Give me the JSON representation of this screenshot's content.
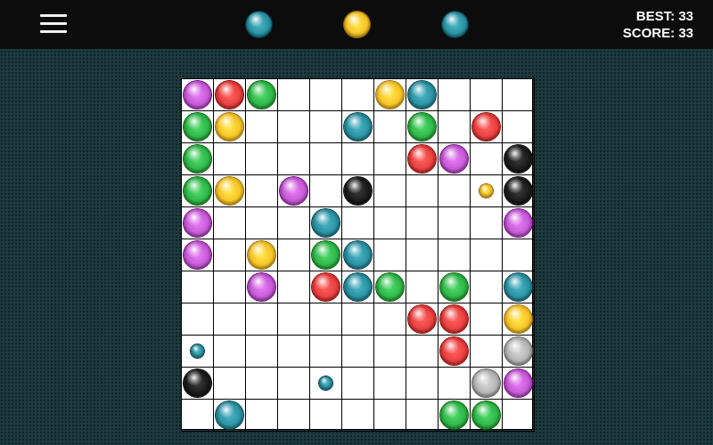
{
  "colors": {
    "purple": "#c75ad6",
    "red": "#e8403f",
    "green": "#2fb84a",
    "yellow": "#f7c427",
    "teal": "#2a93a3",
    "black": "#1a1a1a",
    "gray": "#b5b5b5"
  },
  "header": {
    "menu_icon": "hamburger-menu-icon",
    "next_balls": [
      "teal",
      "yellow",
      "teal"
    ],
    "best_label": "BEST:",
    "best_value": "33",
    "score_label": "SCORE:",
    "score_value": "33"
  },
  "board": {
    "rows": 11,
    "cols": 11,
    "balls": [
      {
        "row": 0,
        "col": 0,
        "color": "purple",
        "size": "big"
      },
      {
        "row": 0,
        "col": 1,
        "color": "red",
        "size": "big"
      },
      {
        "row": 0,
        "col": 2,
        "color": "green",
        "size": "big"
      },
      {
        "row": 0,
        "col": 6,
        "color": "yellow",
        "size": "big"
      },
      {
        "row": 0,
        "col": 7,
        "color": "teal",
        "size": "big"
      },
      {
        "row": 1,
        "col": 0,
        "color": "green",
        "size": "big"
      },
      {
        "row": 1,
        "col": 1,
        "color": "yellow",
        "size": "big"
      },
      {
        "row": 1,
        "col": 5,
        "color": "teal",
        "size": "big"
      },
      {
        "row": 1,
        "col": 7,
        "color": "green",
        "size": "big"
      },
      {
        "row": 1,
        "col": 9,
        "color": "red",
        "size": "big"
      },
      {
        "row": 2,
        "col": 0,
        "color": "green",
        "size": "big"
      },
      {
        "row": 2,
        "col": 7,
        "color": "red",
        "size": "big"
      },
      {
        "row": 2,
        "col": 8,
        "color": "purple",
        "size": "big"
      },
      {
        "row": 2,
        "col": 10,
        "color": "black",
        "size": "big"
      },
      {
        "row": 3,
        "col": 0,
        "color": "green",
        "size": "big"
      },
      {
        "row": 3,
        "col": 1,
        "color": "yellow",
        "size": "big"
      },
      {
        "row": 3,
        "col": 3,
        "color": "purple",
        "size": "big"
      },
      {
        "row": 3,
        "col": 5,
        "color": "black",
        "size": "big"
      },
      {
        "row": 3,
        "col": 9,
        "color": "yellow",
        "size": "small"
      },
      {
        "row": 3,
        "col": 10,
        "color": "black",
        "size": "big"
      },
      {
        "row": 4,
        "col": 0,
        "color": "purple",
        "size": "big"
      },
      {
        "row": 4,
        "col": 4,
        "color": "teal",
        "size": "big"
      },
      {
        "row": 4,
        "col": 10,
        "color": "purple",
        "size": "big"
      },
      {
        "row": 5,
        "col": 0,
        "color": "purple",
        "size": "big"
      },
      {
        "row": 5,
        "col": 2,
        "color": "yellow",
        "size": "big"
      },
      {
        "row": 5,
        "col": 4,
        "color": "green",
        "size": "big"
      },
      {
        "row": 5,
        "col": 5,
        "color": "teal",
        "size": "big"
      },
      {
        "row": 6,
        "col": 2,
        "color": "purple",
        "size": "big"
      },
      {
        "row": 6,
        "col": 4,
        "color": "red",
        "size": "big"
      },
      {
        "row": 6,
        "col": 5,
        "color": "teal",
        "size": "big"
      },
      {
        "row": 6,
        "col": 6,
        "color": "green",
        "size": "big"
      },
      {
        "row": 6,
        "col": 8,
        "color": "green",
        "size": "big"
      },
      {
        "row": 6,
        "col": 10,
        "color": "teal",
        "size": "big"
      },
      {
        "row": 7,
        "col": 7,
        "color": "red",
        "size": "big"
      },
      {
        "row": 7,
        "col": 8,
        "color": "red",
        "size": "big"
      },
      {
        "row": 7,
        "col": 10,
        "color": "yellow",
        "size": "big"
      },
      {
        "row": 8,
        "col": 0,
        "color": "teal",
        "size": "small"
      },
      {
        "row": 8,
        "col": 8,
        "color": "red",
        "size": "big"
      },
      {
        "row": 8,
        "col": 10,
        "color": "gray",
        "size": "big"
      },
      {
        "row": 9,
        "col": 0,
        "color": "black",
        "size": "big"
      },
      {
        "row": 9,
        "col": 4,
        "color": "teal",
        "size": "small"
      },
      {
        "row": 9,
        "col": 9,
        "color": "gray",
        "size": "big"
      },
      {
        "row": 9,
        "col": 10,
        "color": "purple",
        "size": "big"
      },
      {
        "row": 10,
        "col": 1,
        "color": "teal",
        "size": "big"
      },
      {
        "row": 10,
        "col": 8,
        "color": "green",
        "size": "big"
      },
      {
        "row": 10,
        "col": 9,
        "color": "green",
        "size": "big"
      }
    ]
  }
}
